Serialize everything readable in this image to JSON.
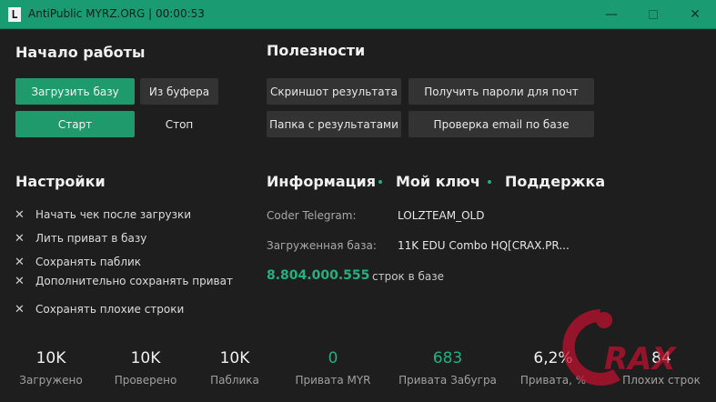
{
  "window": {
    "icon_letter": "L",
    "title": "AntiPublic MYRZ.ORG | 00:00:53",
    "controls": {
      "minimize": "—",
      "maximize": "",
      "close": "✕"
    }
  },
  "start": {
    "heading": "Начало работы",
    "load_base": "Загрузить базу",
    "from_clipboard": "Из буфера",
    "start": "Старт",
    "stop": "Стоп"
  },
  "utilities": {
    "heading": "Полезности",
    "screenshot": "Скриншот результата",
    "get_passwords": "Получить пароли для почт",
    "results_folder": "Папка с результатами",
    "check_email": "Проверка email по базе"
  },
  "settings": {
    "heading": "Настройки",
    "options": [
      "Начать чек после загрузки",
      "Лить приват в базу",
      "Сохранять паблик",
      "Дополнительно сохранять приват",
      "Сохранять плохие строки"
    ]
  },
  "info": {
    "tabs": [
      "Информация",
      "Мой ключ",
      "Поддержка"
    ],
    "telegram_label": "Coder Telegram:",
    "telegram_value": "LOLZTEAM_OLD",
    "base_label": "Загруженная база:",
    "base_value": "11K EDU Combo HQ[CRAX.PR...",
    "line_count": "8.804.000.555",
    "line_count_suffix": "строк в базе"
  },
  "stats": [
    {
      "value": "10K",
      "label": "Загружено",
      "accent": false
    },
    {
      "value": "10K",
      "label": "Проверено",
      "accent": false
    },
    {
      "value": "10K",
      "label": "Паблика",
      "accent": false
    },
    {
      "value": "0",
      "label": "Привата MYR",
      "accent": true
    },
    {
      "value": "683",
      "label": "Привата Забугра",
      "accent": true
    },
    {
      "value": "6,2%",
      "label": "Привата, %",
      "accent": false
    },
    {
      "value": "84",
      "label": "Плохих строк",
      "accent": false
    }
  ],
  "watermark": {
    "text": "RAX",
    "color": "#c8102e"
  },
  "colors": {
    "titlebar": "#1a9b72",
    "accent": "#1f9a6c",
    "background": "#1e1e1e"
  }
}
